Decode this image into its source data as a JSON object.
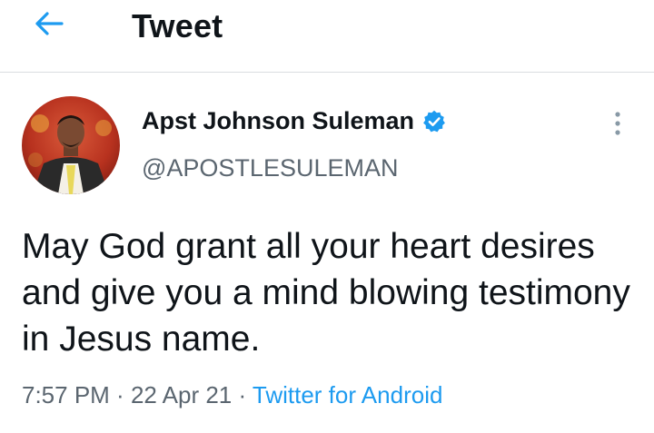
{
  "header": {
    "title": "Tweet",
    "back_icon": "arrow-left-icon",
    "accent": "#1d9bf0"
  },
  "author": {
    "name": "Apst Johnson Suleman",
    "handle": "@APOSTLESULEMAN",
    "verified": true,
    "verified_color": "#1d9bf0"
  },
  "tweet": {
    "text": "May God grant all your heart desires and give you a mind blowing testimony in Jesus name."
  },
  "meta": {
    "time": "7:57 PM",
    "separator": " · ",
    "date": "22 Apr 21",
    "source": "Twitter for Android"
  },
  "more_icon": "more-vertical-icon"
}
